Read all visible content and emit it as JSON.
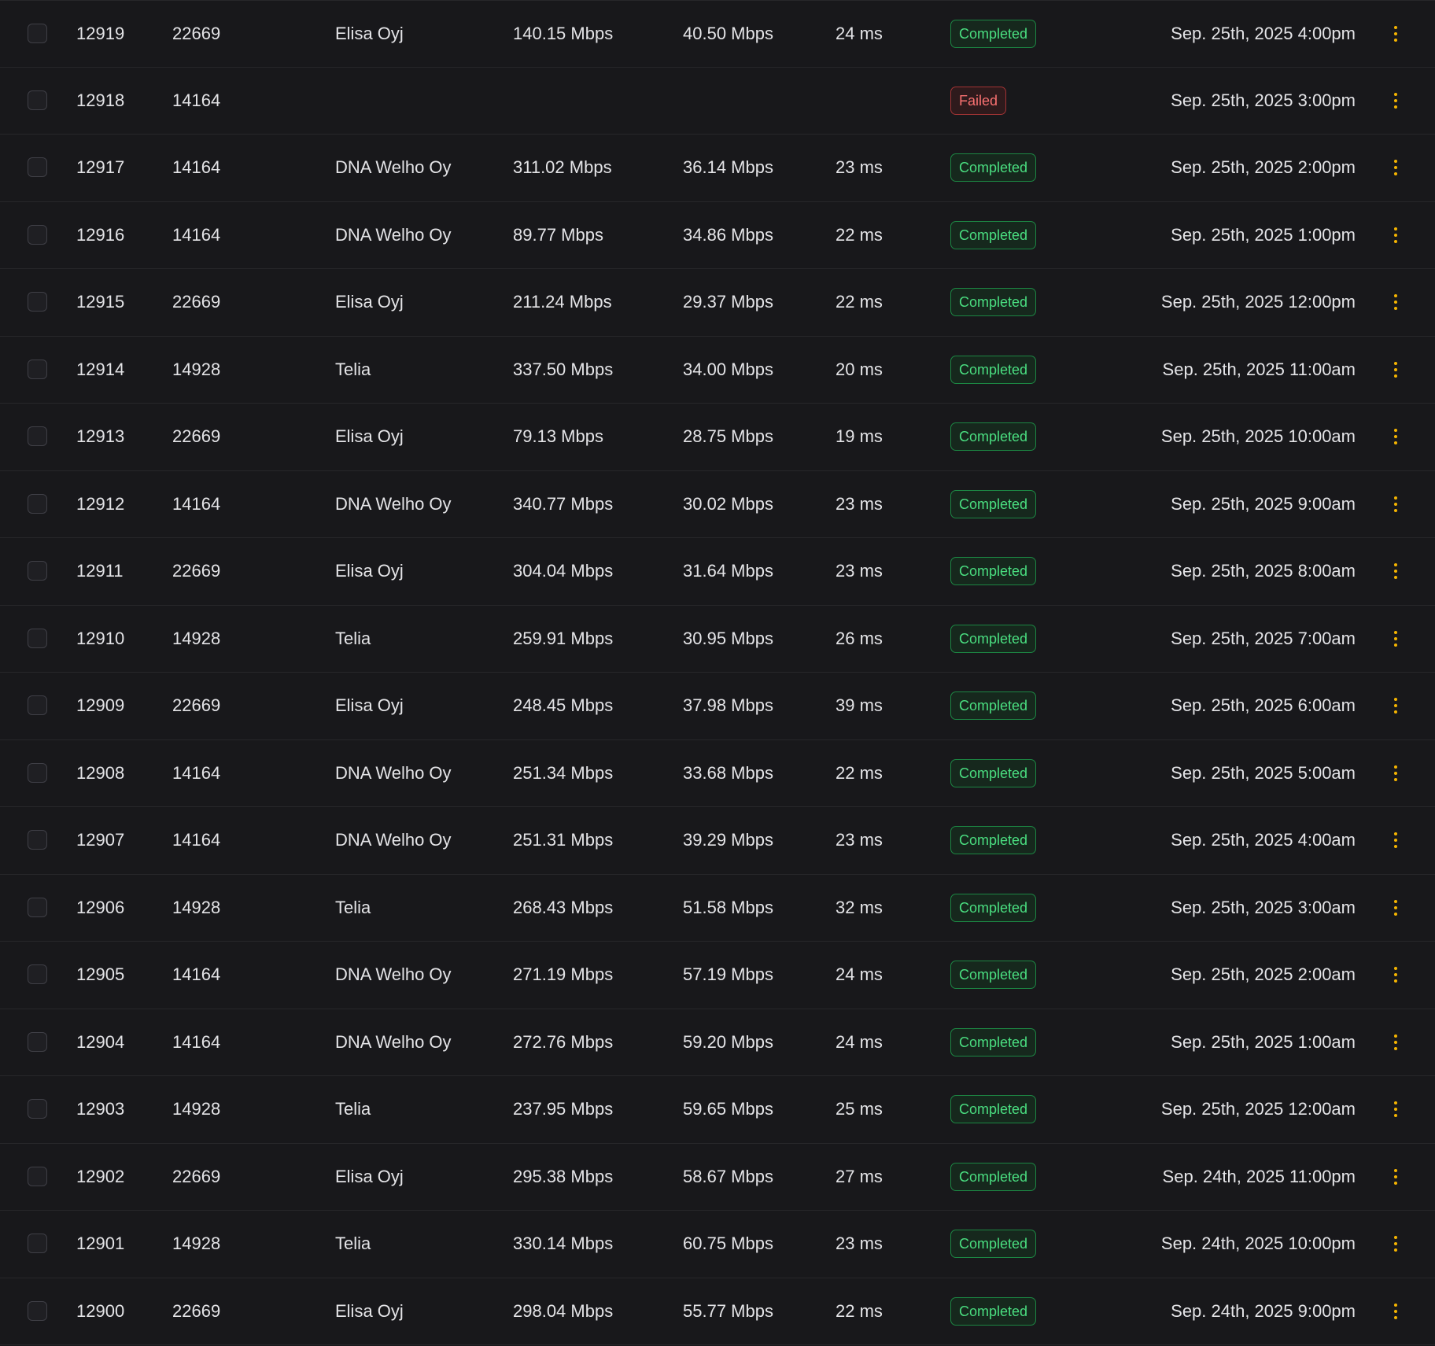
{
  "theme": {
    "background": "#18181b",
    "row_divider": "#27272a",
    "text": "#e4e4e7",
    "success": "#4ade80",
    "danger": "#f87171",
    "menu_dots": "#f5b400"
  },
  "rows": [
    {
      "id": "12919",
      "server": "22669",
      "isp": "Elisa Oyj",
      "download": "140.15 Mbps",
      "upload": "40.50 Mbps",
      "ping": "24 ms",
      "status": "Completed",
      "status_type": "ok",
      "date": "Sep. 25th, 2025 4:00pm"
    },
    {
      "id": "12918",
      "server": "14164",
      "isp": "",
      "download": "",
      "upload": "",
      "ping": "",
      "status": "Failed",
      "status_type": "fail",
      "date": "Sep. 25th, 2025 3:00pm"
    },
    {
      "id": "12917",
      "server": "14164",
      "isp": "DNA Welho Oy",
      "download": "311.02 Mbps",
      "upload": "36.14 Mbps",
      "ping": "23 ms",
      "status": "Completed",
      "status_type": "ok",
      "date": "Sep. 25th, 2025 2:00pm"
    },
    {
      "id": "12916",
      "server": "14164",
      "isp": "DNA Welho Oy",
      "download": "89.77 Mbps",
      "upload": "34.86 Mbps",
      "ping": "22 ms",
      "status": "Completed",
      "status_type": "ok",
      "date": "Sep. 25th, 2025 1:00pm"
    },
    {
      "id": "12915",
      "server": "22669",
      "isp": "Elisa Oyj",
      "download": "211.24 Mbps",
      "upload": "29.37 Mbps",
      "ping": "22 ms",
      "status": "Completed",
      "status_type": "ok",
      "date": "Sep. 25th, 2025 12:00pm"
    },
    {
      "id": "12914",
      "server": "14928",
      "isp": "Telia",
      "download": "337.50 Mbps",
      "upload": "34.00 Mbps",
      "ping": "20 ms",
      "status": "Completed",
      "status_type": "ok",
      "date": "Sep. 25th, 2025 11:00am"
    },
    {
      "id": "12913",
      "server": "22669",
      "isp": "Elisa Oyj",
      "download": "79.13 Mbps",
      "upload": "28.75 Mbps",
      "ping": "19 ms",
      "status": "Completed",
      "status_type": "ok",
      "date": "Sep. 25th, 2025 10:00am"
    },
    {
      "id": "12912",
      "server": "14164",
      "isp": "DNA Welho Oy",
      "download": "340.77 Mbps",
      "upload": "30.02 Mbps",
      "ping": "23 ms",
      "status": "Completed",
      "status_type": "ok",
      "date": "Sep. 25th, 2025 9:00am"
    },
    {
      "id": "12911",
      "server": "22669",
      "isp": "Elisa Oyj",
      "download": "304.04 Mbps",
      "upload": "31.64 Mbps",
      "ping": "23 ms",
      "status": "Completed",
      "status_type": "ok",
      "date": "Sep. 25th, 2025 8:00am"
    },
    {
      "id": "12910",
      "server": "14928",
      "isp": "Telia",
      "download": "259.91 Mbps",
      "upload": "30.95 Mbps",
      "ping": "26 ms",
      "status": "Completed",
      "status_type": "ok",
      "date": "Sep. 25th, 2025 7:00am"
    },
    {
      "id": "12909",
      "server": "22669",
      "isp": "Elisa Oyj",
      "download": "248.45 Mbps",
      "upload": "37.98 Mbps",
      "ping": "39 ms",
      "status": "Completed",
      "status_type": "ok",
      "date": "Sep. 25th, 2025 6:00am"
    },
    {
      "id": "12908",
      "server": "14164",
      "isp": "DNA Welho Oy",
      "download": "251.34 Mbps",
      "upload": "33.68 Mbps",
      "ping": "22 ms",
      "status": "Completed",
      "status_type": "ok",
      "date": "Sep. 25th, 2025 5:00am"
    },
    {
      "id": "12907",
      "server": "14164",
      "isp": "DNA Welho Oy",
      "download": "251.31 Mbps",
      "upload": "39.29 Mbps",
      "ping": "23 ms",
      "status": "Completed",
      "status_type": "ok",
      "date": "Sep. 25th, 2025 4:00am"
    },
    {
      "id": "12906",
      "server": "14928",
      "isp": "Telia",
      "download": "268.43 Mbps",
      "upload": "51.58 Mbps",
      "ping": "32 ms",
      "status": "Completed",
      "status_type": "ok",
      "date": "Sep. 25th, 2025 3:00am"
    },
    {
      "id": "12905",
      "server": "14164",
      "isp": "DNA Welho Oy",
      "download": "271.19 Mbps",
      "upload": "57.19 Mbps",
      "ping": "24 ms",
      "status": "Completed",
      "status_type": "ok",
      "date": "Sep. 25th, 2025 2:00am"
    },
    {
      "id": "12904",
      "server": "14164",
      "isp": "DNA Welho Oy",
      "download": "272.76 Mbps",
      "upload": "59.20 Mbps",
      "ping": "24 ms",
      "status": "Completed",
      "status_type": "ok",
      "date": "Sep. 25th, 2025 1:00am"
    },
    {
      "id": "12903",
      "server": "14928",
      "isp": "Telia",
      "download": "237.95 Mbps",
      "upload": "59.65 Mbps",
      "ping": "25 ms",
      "status": "Completed",
      "status_type": "ok",
      "date": "Sep. 25th, 2025 12:00am"
    },
    {
      "id": "12902",
      "server": "22669",
      "isp": "Elisa Oyj",
      "download": "295.38 Mbps",
      "upload": "58.67 Mbps",
      "ping": "27 ms",
      "status": "Completed",
      "status_type": "ok",
      "date": "Sep. 24th, 2025 11:00pm"
    },
    {
      "id": "12901",
      "server": "14928",
      "isp": "Telia",
      "download": "330.14 Mbps",
      "upload": "60.75 Mbps",
      "ping": "23 ms",
      "status": "Completed",
      "status_type": "ok",
      "date": "Sep. 24th, 2025 10:00pm"
    },
    {
      "id": "12900",
      "server": "22669",
      "isp": "Elisa Oyj",
      "download": "298.04 Mbps",
      "upload": "55.77 Mbps",
      "ping": "22 ms",
      "status": "Completed",
      "status_type": "ok",
      "date": "Sep. 24th, 2025 9:00pm"
    }
  ]
}
